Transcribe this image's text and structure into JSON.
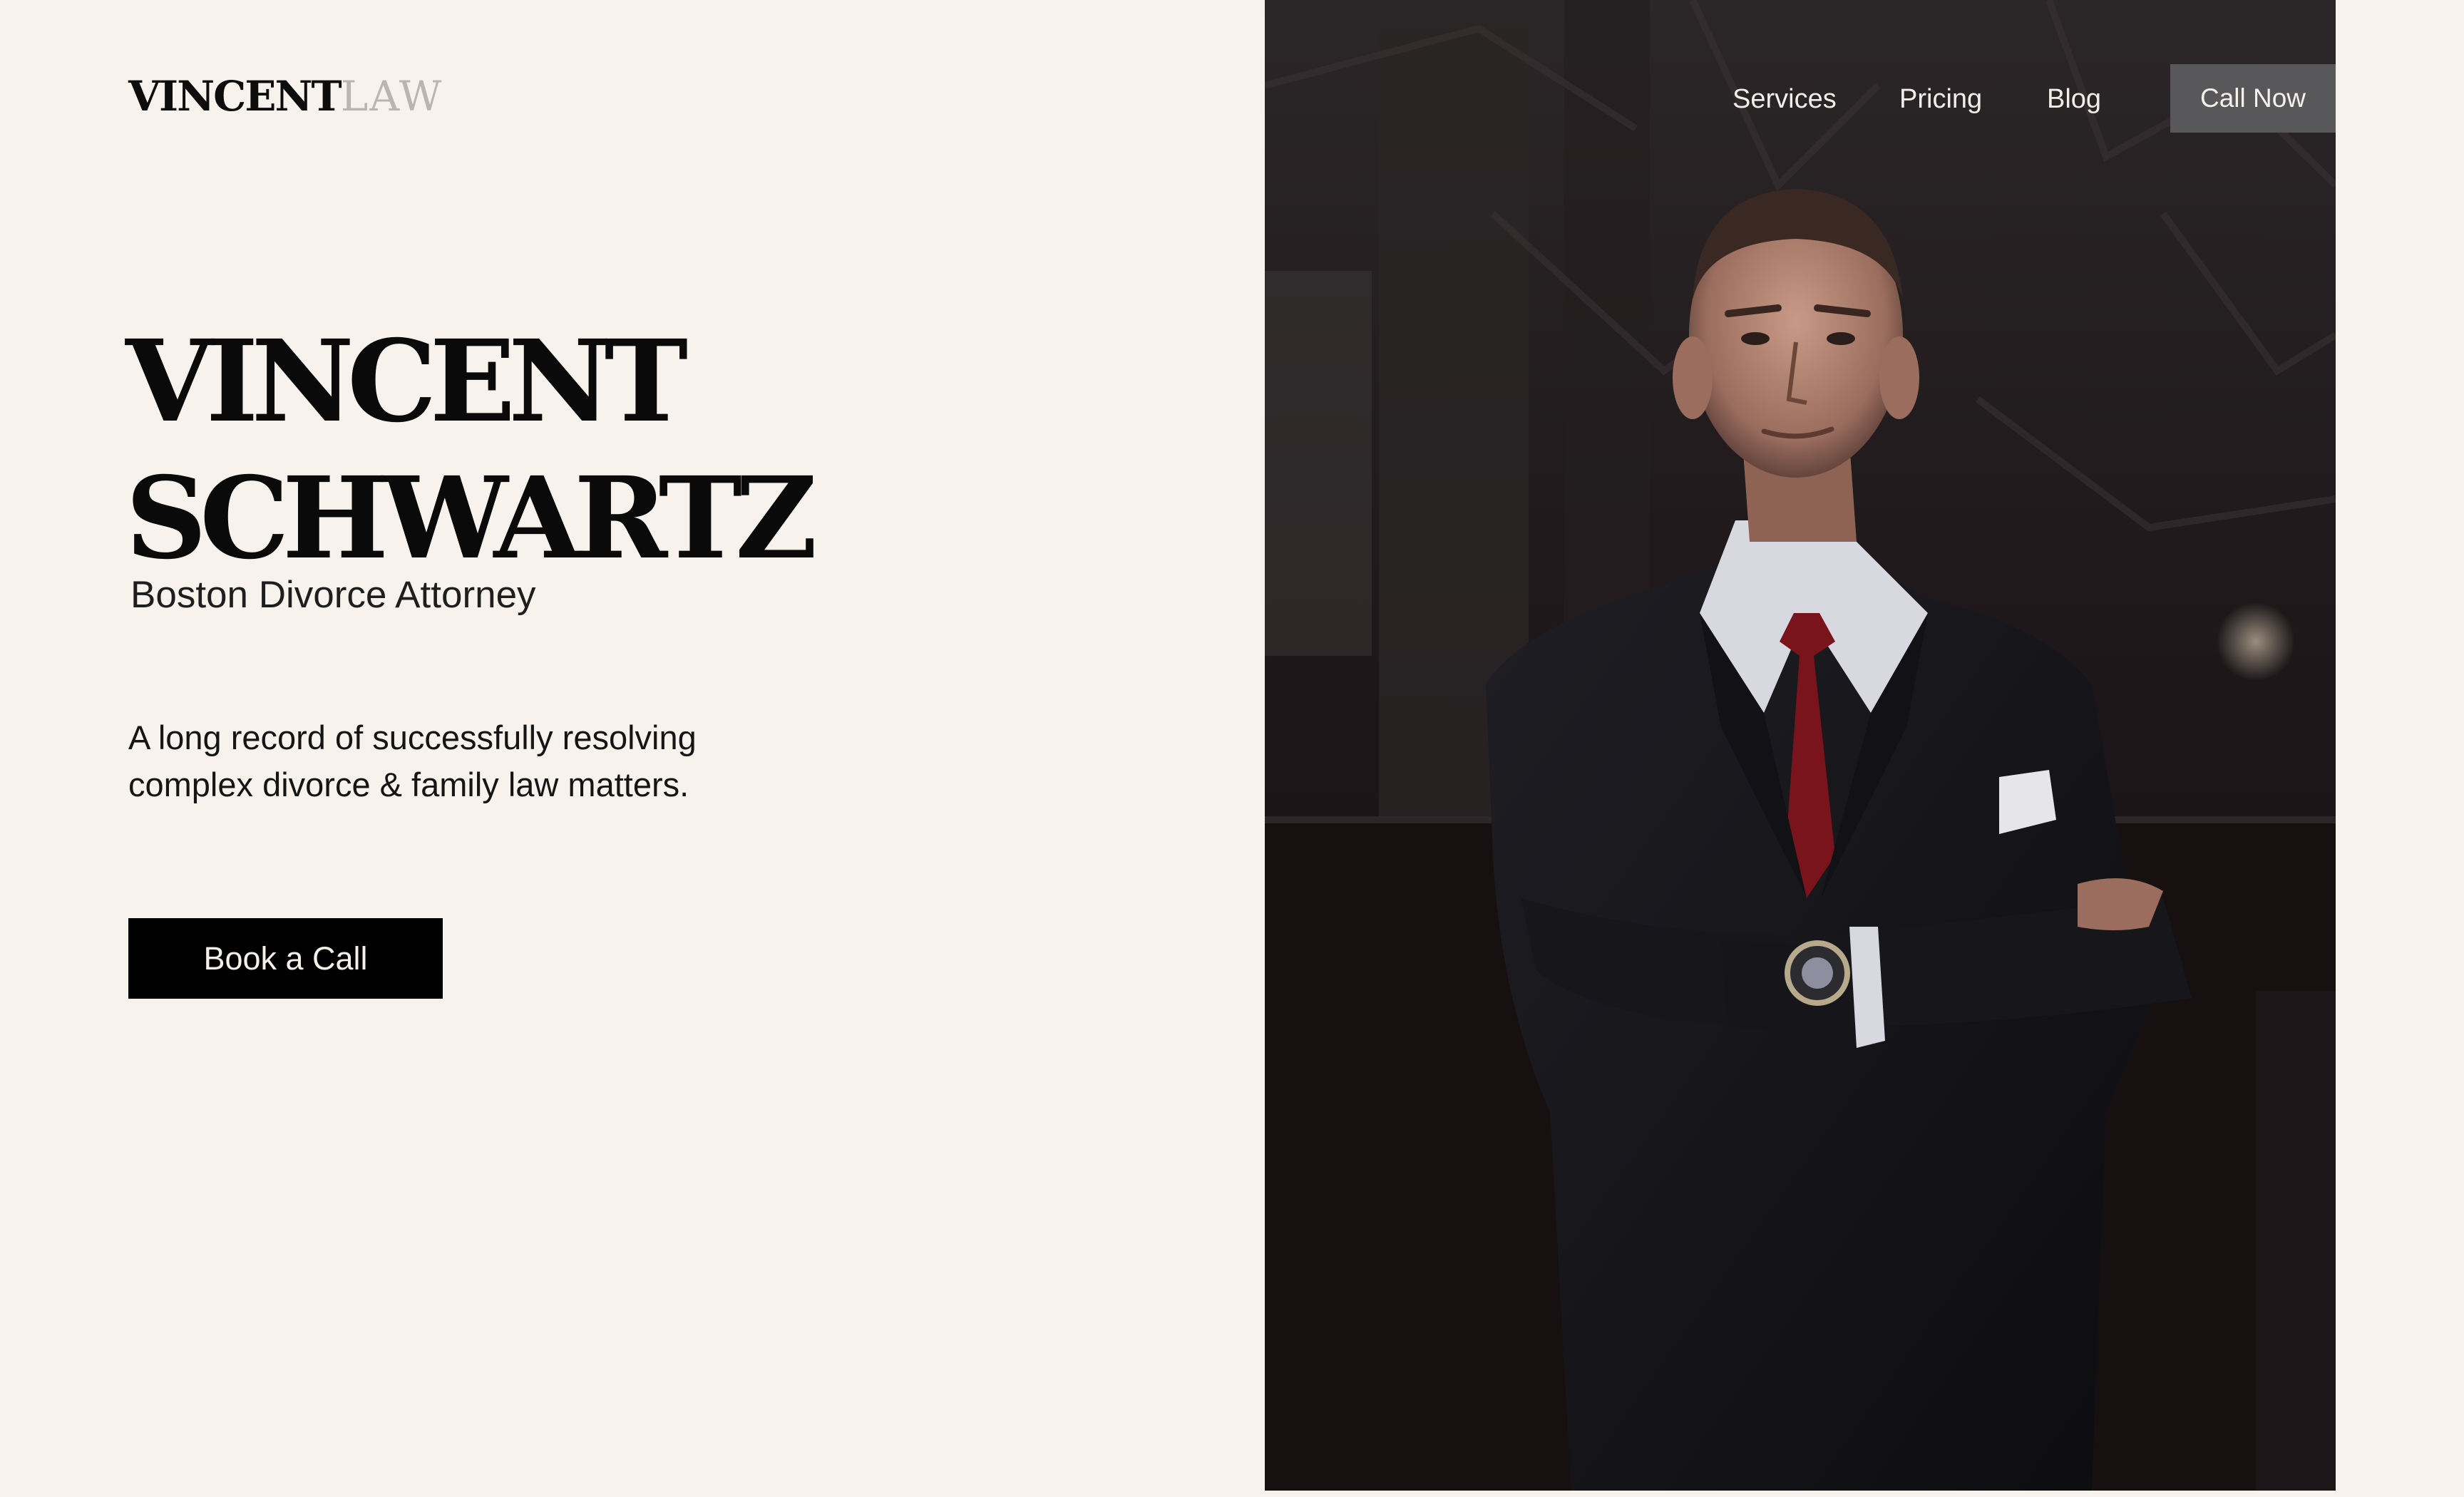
{
  "brand": {
    "name_main": "VINCENT",
    "name_sub": "LAW"
  },
  "nav": {
    "items": [
      {
        "label": "Services"
      },
      {
        "label": "Pricing"
      },
      {
        "label": "Blog"
      }
    ],
    "cta_label": "Call Now"
  },
  "hero": {
    "title_line1": "VINCENT",
    "title_line2": "SCHWARTZ",
    "subtitle": "Boston Divorce Attorney",
    "description": "A long record of successfully resolving complex divorce & family law matters.",
    "button_label": "Book a Call"
  },
  "colors": {
    "background": "#f7f3ec",
    "text": "#0a0a0a",
    "logo_accent": "#b9b6b0",
    "button_bg": "#000000",
    "call_button_bg": "#58575a",
    "tie": "#7a141c"
  },
  "photo": {
    "subject": "attorney-portrait"
  }
}
